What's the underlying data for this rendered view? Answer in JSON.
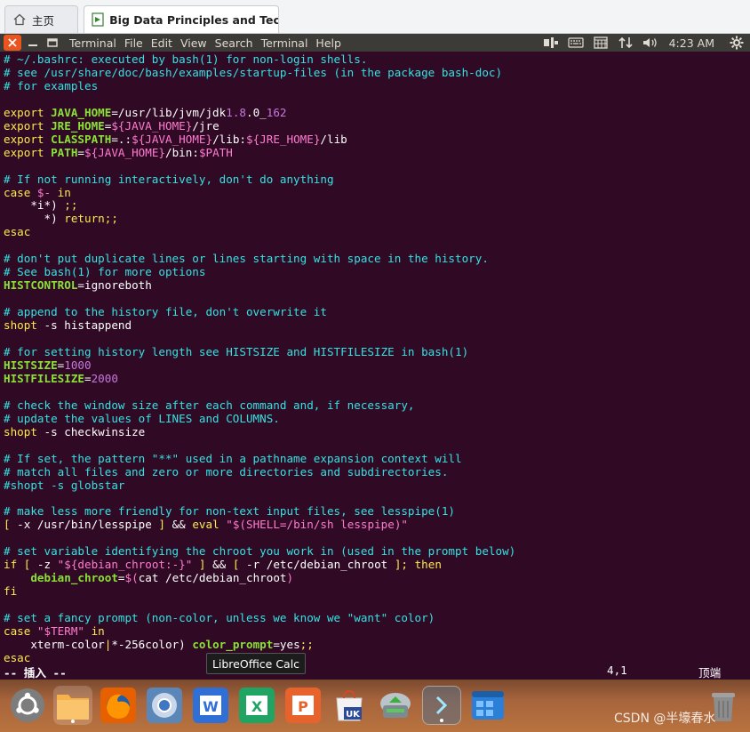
{
  "browser": {
    "tabs": [
      {
        "label": "主页"
      },
      {
        "label": "Big Data Principles and Tech..."
      }
    ]
  },
  "panel": {
    "menu": [
      "Terminal",
      "File",
      "Edit",
      "View",
      "Search",
      "Terminal",
      "Help"
    ],
    "clock": "4:23 AM"
  },
  "editor": {
    "lines": [
      [
        [
          "c-com",
          "# ~/.bashrc: executed by bash(1) for non-login shells."
        ]
      ],
      [
        [
          "c-com",
          "# see /usr/share/doc/bash/examples/startup-files (in the package bash-doc)"
        ]
      ],
      [
        [
          "c-com",
          "# for examples"
        ]
      ],
      [],
      [
        [
          "c-kw",
          "export "
        ],
        [
          "c-var",
          "JAVA_HOME"
        ],
        [
          "",
          "=/usr/lib/jvm/jdk"
        ],
        [
          "c-num",
          "1.8"
        ],
        [
          "",
          ".0_"
        ],
        [
          "c-num",
          "162"
        ]
      ],
      [
        [
          "c-kw",
          "export "
        ],
        [
          "c-var",
          "JRE_HOME"
        ],
        [
          "",
          "="
        ],
        [
          "c-str",
          "${JAVA_HOME}"
        ],
        [
          "",
          "/jre"
        ]
      ],
      [
        [
          "c-kw",
          "export "
        ],
        [
          "c-var",
          "CLASSPATH"
        ],
        [
          "",
          "=.:"
        ],
        [
          "c-str",
          "${JAVA_HOME}"
        ],
        [
          "",
          "/lib:"
        ],
        [
          "c-str",
          "${JRE_HOME}"
        ],
        [
          "",
          "/lib"
        ]
      ],
      [
        [
          "c-kw",
          "export "
        ],
        [
          "c-var",
          "PATH"
        ],
        [
          "",
          "="
        ],
        [
          "c-str",
          "${JAVA_HOME}"
        ],
        [
          "",
          "/bin:"
        ],
        [
          "c-str",
          "$PATH"
        ]
      ],
      [],
      [
        [
          "c-com",
          "# If not running interactively, don't do anything"
        ]
      ],
      [
        [
          "c-kw",
          "case "
        ],
        [
          "c-str",
          "$-"
        ],
        [
          "c-kw",
          " in"
        ]
      ],
      [
        [
          "",
          "    *i*) "
        ],
        [
          "c-kw",
          ";;"
        ]
      ],
      [
        [
          "",
          "      *) "
        ],
        [
          "c-kw",
          "return;;"
        ]
      ],
      [
        [
          "c-kw",
          "esac"
        ]
      ],
      [],
      [
        [
          "c-com",
          "# don't put duplicate lines or lines starting with space in the history."
        ]
      ],
      [
        [
          "c-com",
          "# See bash(1) for more options"
        ]
      ],
      [
        [
          "c-var",
          "HISTCONTROL"
        ],
        [
          "",
          "=ignoreboth"
        ]
      ],
      [],
      [
        [
          "c-com",
          "# append to the history file, don't overwrite it"
        ]
      ],
      [
        [
          "c-kw",
          "shopt"
        ],
        [
          "",
          " -s histappend"
        ]
      ],
      [],
      [
        [
          "c-com",
          "# for setting history length see HISTSIZE and HISTFILESIZE in bash(1)"
        ]
      ],
      [
        [
          "c-var",
          "HISTSIZE"
        ],
        [
          "",
          "="
        ],
        [
          "c-num",
          "1000"
        ]
      ],
      [
        [
          "c-var",
          "HISTFILESIZE"
        ],
        [
          "",
          "="
        ],
        [
          "c-num",
          "2000"
        ]
      ],
      [],
      [
        [
          "c-com",
          "# check the window size after each command and, if necessary,"
        ]
      ],
      [
        [
          "c-com",
          "# update the values of LINES and COLUMNS."
        ]
      ],
      [
        [
          "c-kw",
          "shopt"
        ],
        [
          "",
          " -s checkwinsize"
        ]
      ],
      [],
      [
        [
          "c-com",
          "# If set, the pattern \"**\" used in a pathname expansion context will"
        ]
      ],
      [
        [
          "c-com",
          "# match all files and zero or more directories and subdirectories."
        ]
      ],
      [
        [
          "c-com",
          "#shopt -s globstar"
        ]
      ],
      [],
      [
        [
          "c-com",
          "# make less more friendly for non-text input files, see lesspipe(1)"
        ]
      ],
      [
        [
          "c-kw",
          "[ "
        ],
        [
          "",
          "-x /usr/bin/lesspipe "
        ],
        [
          "c-kw",
          "]"
        ],
        [
          "",
          " && "
        ],
        [
          "c-kw",
          "eval "
        ],
        [
          "c-str",
          "\"$(SHELL=/bin/sh lesspipe)\""
        ]
      ],
      [],
      [
        [
          "c-com",
          "# set variable identifying the chroot you work in (used in the prompt below)"
        ]
      ],
      [
        [
          "c-kw",
          "if [ "
        ],
        [
          "",
          "-z "
        ],
        [
          "c-str",
          "\"${debian_chroot:-}\""
        ],
        [
          "c-kw",
          " ]"
        ],
        [
          "",
          " && "
        ],
        [
          "c-kw",
          "[ "
        ],
        [
          "",
          "-r /etc/debian_chroot "
        ],
        [
          "c-kw",
          "]; then"
        ]
      ],
      [
        [
          "",
          "    "
        ],
        [
          "c-var",
          "debian_chroot"
        ],
        [
          "",
          "="
        ],
        [
          "c-str",
          "$("
        ],
        [
          "",
          "cat /etc/debian_chroot"
        ],
        [
          "c-str",
          ")"
        ]
      ],
      [
        [
          "c-kw",
          "fi"
        ]
      ],
      [],
      [
        [
          "c-com",
          "# set a fancy prompt (non-color, unless we know we \"want\" color)"
        ]
      ],
      [
        [
          "c-kw",
          "case "
        ],
        [
          "c-str",
          "\"$TERM\""
        ],
        [
          "c-kw",
          " in"
        ]
      ],
      [
        [
          "",
          "    xterm-color"
        ],
        [
          "c-kw",
          "|"
        ],
        [
          "",
          "*-256color) "
        ],
        [
          "c-var",
          "color_prompt"
        ],
        [
          "",
          "=yes"
        ],
        [
          "c-kw",
          ";;"
        ]
      ],
      [
        [
          "c-kw",
          "esac"
        ]
      ]
    ],
    "status": {
      "mode": "-- 插入 --",
      "position": "4,1",
      "scroll": "顶端"
    }
  },
  "tooltip": "LibreOffice Calc",
  "dock": {
    "items": [
      {
        "icon": "ubuntu-logo-icon",
        "color": "#dd4814"
      },
      {
        "icon": "files-folder-icon",
        "color": "#f0a030"
      },
      {
        "icon": "firefox-icon",
        "color": "#e66000"
      },
      {
        "icon": "chromium-icon",
        "color": "#4c7fbf"
      },
      {
        "icon": "wps-writer-icon",
        "color": "#2f6fd6"
      },
      {
        "icon": "wps-spreadsheets-icon",
        "color": "#1fa463"
      },
      {
        "icon": "wps-presentation-icon",
        "color": "#e8632c"
      },
      {
        "icon": "ubuntu-software-icon",
        "color": "#d14a2a"
      },
      {
        "icon": "software-updater-icon",
        "color": "#9aa6ad"
      },
      {
        "icon": "terminal-icon",
        "color": "#4e5d6c"
      },
      {
        "icon": "workspace-switcher-icon",
        "color": "#2c7fd6"
      },
      {
        "icon": "trash-icon",
        "color": "#888888"
      }
    ]
  },
  "watermark": "CSDN @半壕春水"
}
